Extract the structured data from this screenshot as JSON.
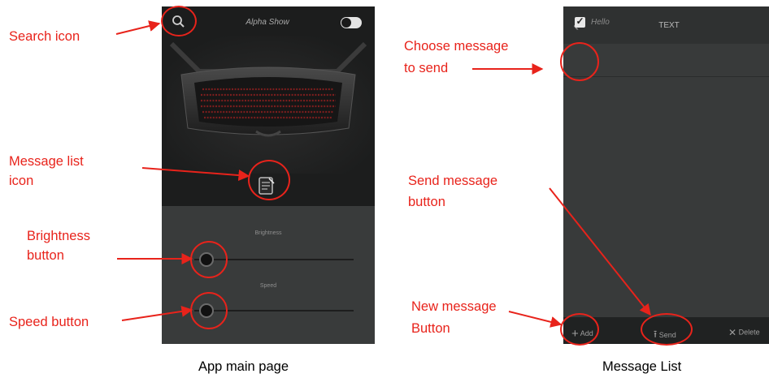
{
  "main_page": {
    "app_title": "Alpha Show",
    "sliders": [
      {
        "label": "Brightness"
      },
      {
        "label": "Speed"
      }
    ],
    "caption": "App main page"
  },
  "message_list": {
    "title": "TEXT",
    "messages": [
      {
        "text": "Hello",
        "checked": true
      }
    ],
    "footer": {
      "add_label": "Add",
      "send_label": "Send",
      "delete_label": "Delete"
    },
    "caption": "Message List"
  },
  "annotations": {
    "search_icon": "Search icon",
    "message_list_icon_line1": "Message list",
    "message_list_icon_line2": "icon",
    "brightness_line1": "Brightness",
    "brightness_line2": "button",
    "speed": "Speed button",
    "choose_line1": "Choose message",
    "choose_line2": "to send",
    "send_line1": "Send message",
    "send_line2": "button",
    "new_line1": "New message",
    "new_line2": "Button"
  },
  "colors": {
    "annotation": "#e8231b",
    "phone_dark": "#1c1d1d",
    "phone_panel": "#393b3b"
  },
  "icons": [
    "search-icon",
    "toggle-switch",
    "message-list-icon",
    "back-chevron-icon",
    "checkbox-icon",
    "add-icon",
    "send-icon",
    "delete-icon"
  ]
}
